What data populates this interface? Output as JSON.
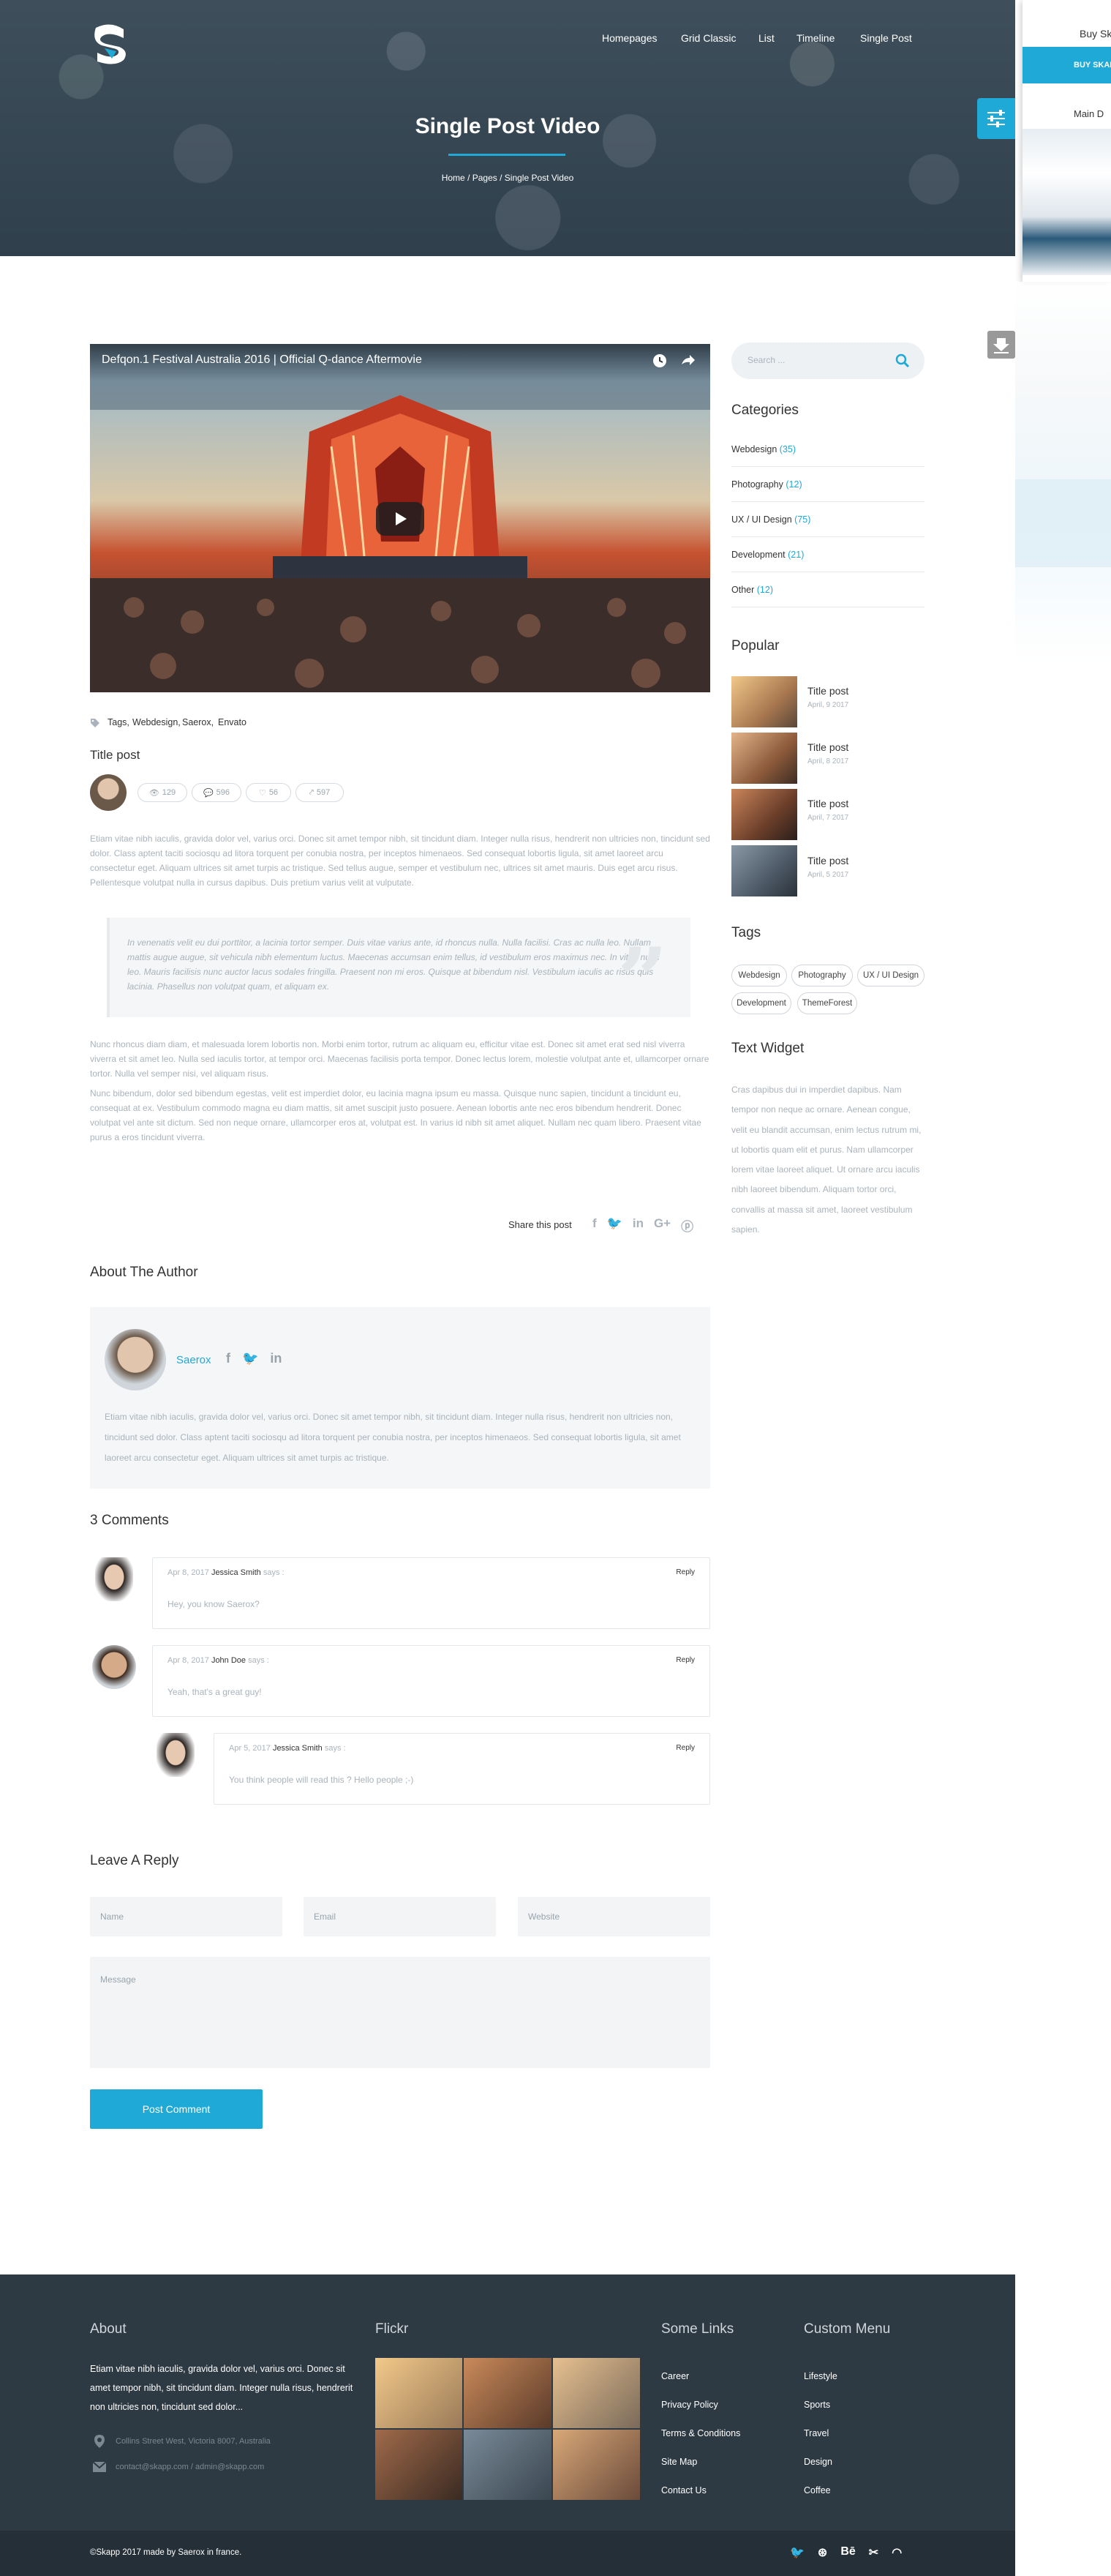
{
  "colors": {
    "accent": "#1fa9d6",
    "dark": "#2e3a43",
    "hero": "#3e4f5b"
  },
  "nav": {
    "items": [
      "Homepages",
      "Grid Classic",
      "List",
      "Timeline",
      "Single Post"
    ]
  },
  "hero": {
    "title": "Single Post Video",
    "breadcrumbs": [
      "Home",
      "Pages",
      "Single Post Video"
    ]
  },
  "demo": {
    "title": "Buy Sk",
    "button": "BUY SKAP",
    "subtitle": "Main D"
  },
  "video": {
    "title": "Defqon.1 Festival Australia 2016 | Official Q-dance Aftermovie"
  },
  "post": {
    "tags_label": "Tags,",
    "tags": [
      "Webdesign,",
      "Saerox,",
      "Envato"
    ],
    "title": "Title post",
    "stats": {
      "views": "129",
      "comments": "596",
      "likes": "56",
      "shares": "597"
    },
    "p1": "Etiam vitae nibh iaculis, gravida dolor vel, varius orci. Donec sit amet tempor nibh, sit tincidunt diam. Integer nulla risus, hendrerit non ultricies non, tincidunt sed dolor. Class aptent taciti sociosqu ad litora torquent per conubia nostra, per inceptos himenaeos. Sed consequat lobortis ligula, sit amet laoreet arcu consectetur eget. Aliquam ultrices sit amet turpis ac tristique. Sed tellus augue, semper et vestibulum nec, ultrices sit amet mauris. Duis eget arcu risus. Pellentesque volutpat nulla in cursus dapibus. Duis pretium varius velit at vulputate.",
    "quote": "In venenatis velit eu dui porttitor, a lacinia tortor semper. Duis vitae varius ante, id rhoncus nulla. Nulla facilisi. Cras ac nulla leo. Nullam mattis augue augue, sit vehicula nibh elementum luctus. Maecenas accumsan enim tellus, id vestibulum eros maximus nec. In vitae nunc leo. Mauris facilisis nunc auctor lacus sodales fringilla. Praesent non mi eros. Quisque at bibendum nisl. Vestibulum iaculis ac risus quis lacinia. Phasellus non volutpat quam, et aliquam ex.",
    "p2": "Nunc rhoncus diam diam, et malesuada lorem lobortis non. Morbi enim tortor, rutrum ac aliquam eu, efficitur vitae est. Donec sit amet erat sed nisl viverra viverra et sit amet leo. Nulla sed iaculis tortor, at tempor orci. Maecenas facilisis porta tempor. Donec lectus lorem, molestie volutpat ante et, ullamcorper ornare tortor. Nulla vel semper nisi, vel aliquam risus.",
    "p3": "Nunc bibendum, dolor sed bibendum egestas, velit est imperdiet dolor, eu lacinia magna ipsum eu massa. Quisque nunc sapien, tincidunt a tincidunt eu, consequat at ex. Vestibulum commodo magna eu diam mattis, sit amet suscipit justo posuere. Aenean lobortis ante nec eros bibendum hendrerit. Donec volutpat vel ante sit dictum. Sed non neque ornare, ullamcorper eros at, volutpat est. In varius id nibh sit amet aliquet. Nullam nec quam libero. Praesent vitae purus a eros tincidunt viverra.",
    "share_label": "Share this post"
  },
  "author": {
    "heading": "About The Author",
    "name": "Saerox",
    "bio": "Etiam vitae nibh iaculis, gravida dolor vel, varius orci. Donec sit amet tempor nibh, sit tincidunt diam. Integer nulla risus, hendrerit non ultricies non, tincidunt sed dolor. Class aptent taciti sociosqu ad litora torquent per conubia nostra, per inceptos himenaeos. Sed consequat lobortis ligula, sit amet laoreet arcu consectetur eget. Aliquam ultrices sit amet turpis ac tristique."
  },
  "comments": {
    "heading": "3 Comments",
    "items": [
      {
        "date": "Apr 8, 2017",
        "name": "Jessica Smith",
        "says": "says :",
        "reply": "Reply",
        "text": "Hey, you know Saerox?"
      },
      {
        "date": "Apr 8, 2017",
        "name": "John Doe",
        "says": "says :",
        "reply": "Reply",
        "text": "Yeah, that's a great guy!"
      },
      {
        "date": "Apr 5, 2017",
        "name": "Jessica Smith",
        "says": "says :",
        "reply": "Reply",
        "text": "You think people will read this ? Hello people ;-)"
      }
    ]
  },
  "reply": {
    "heading": "Leave A Reply",
    "name_ph": "Name",
    "email_ph": "Email",
    "website_ph": "Website",
    "message_ph": "Message",
    "submit": "Post Comment"
  },
  "sidebar": {
    "search_ph": "Search ...",
    "categories_heading": "Categories",
    "categories": [
      {
        "name": "Webdesign",
        "count": "(35)"
      },
      {
        "name": "Photography",
        "count": "(12)"
      },
      {
        "name": "UX / UI Design",
        "count": "(75)"
      },
      {
        "name": "Development",
        "count": "(21)"
      },
      {
        "name": "Other",
        "count": "(12)"
      }
    ],
    "popular_heading": "Popular",
    "popular": [
      {
        "title": "Title post",
        "date": "April, 9 2017"
      },
      {
        "title": "Title post",
        "date": "April, 8 2017"
      },
      {
        "title": "Title post",
        "date": "April, 7 2017"
      },
      {
        "title": "Title post",
        "date": "April, 5 2017"
      }
    ],
    "tags_heading": "Tags",
    "tags": [
      "Webdesign",
      "Photography",
      "UX / UI Design",
      "Development",
      "ThemeForest"
    ],
    "widget_heading": "Text Widget",
    "widget_text": "Cras dapibus dui in imperdiet dapibus. Nam tempor non neque ac ornare. Aenean congue, velit eu blandit accumsan, enim lectus rutrum mi, ut lobortis quam elit et purus. Nam ullamcorper lorem vitae laoreet aliquet. Ut ornare arcu iaculis nibh laoreet bibendum. Aliquam tortor orci, convallis at massa sit amet, laoreet vestibulum sapien."
  },
  "footer": {
    "about_heading": "About",
    "about_text": "Etiam vitae nibh iaculis, gravida dolor vel, varius orci. Donec sit amet tempor nibh, sit tincidunt diam. Integer nulla risus, hendrerit non ultricies non, tincidunt sed dolor...",
    "address": "Collins Street West, Victoria 8007, Australia",
    "email": "contact@skapp.com / admin@skapp.com",
    "flickr_heading": "Flickr",
    "links_heading": "Some Links",
    "links": [
      "Career",
      "Privacy Policy",
      "Terms & Conditions",
      "Site Map",
      "Contact Us"
    ],
    "menu_heading": "Custom Menu",
    "menu": [
      "Lifestyle",
      "Sports",
      "Travel",
      "Design",
      "Coffee"
    ],
    "copyright": "©Skapp 2017 made by Saerox in france."
  }
}
